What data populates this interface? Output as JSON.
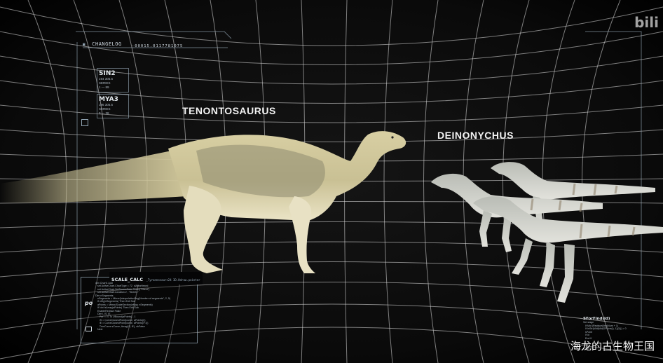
{
  "watermark": "海龙的古生物王国",
  "corner_logo": "bili",
  "species": {
    "tenontosaurus": "TENONTOSAURUS",
    "deinonychus": "DEINONYCHUS"
  },
  "changelog": {
    "title": "CHANGELOG",
    "code": "-00015.0117781075"
  },
  "side_boxes": [
    {
      "title": "SIN2",
      "lines": [
        "194 305.5",
        "SERIES",
        "1 — 89"
      ]
    },
    {
      "title": "MYA3",
      "lines": [
        "196 305.5",
        "SERIES",
        "9 — 38"
      ]
    }
  ],
  "scale_calc": {
    "title": "SCALE_CALC",
    "subtitle": "_Tyrannosaurs24 3D.Hdraw.pointer",
    "po_label": "po",
    "code_lines": [
      "dim Chart1 Add",
      "   set ActiveChart.ChartType = 72  xlAreaHexed",
      "   set ActiveChart.SetSourceData Sheet(\"Sheet\")",
      "   set ActiveChart.Location 2 , \"Sheet1\"",
      "",
      "Dim nSegments",
      "   nSegments = Mirror(InterpolationSeg(Number of segments\", 2, 5)",
      "   If nMy(nSegments) Then Exit Sub",
      "",
      "   aPoints = Mirror(ScaleSection(nMay, nSegments)",
      "   If Not IsArray(aPoints) Then Exit Sub",
      "   EnableRedraw False",
      "",
      "   Dim i, iS, iE",
      "      For i = 0 To UBound(aPoints) - 1",
      "      iS = CurveClosestPoint(curve, aPoints(i))",
      "      iE = CurveClosestPoint(curve, aPoints(i+1))",
      "      TrimCurve sCurve, Array(iS, iE), vbFalse",
      "   Next"
    ]
  },
  "right_note": {
    "title": "SForFind(id)",
    "lines": [
      "Set stage",
      "   If Mid (Replace(line(Num + 1)",
      "   If InStr(Mid(Mid(SPLine(i), 1)(2))) > 0",
      "   sPoint",
      "   If id",
      "   End If",
      "   i",
      "   i",
      "   End Fn"
    ]
  }
}
